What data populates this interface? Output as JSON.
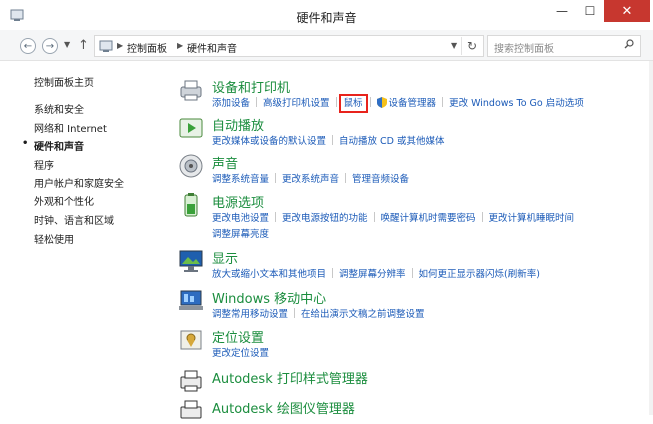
{
  "window": {
    "title": "硬件和声音",
    "close": "✕",
    "max": "☐",
    "min": "—"
  },
  "address": {
    "crumbs": [
      "控制面板",
      "硬件和声音"
    ],
    "search_placeholder": "搜索控制面板"
  },
  "sidebar": {
    "items": [
      "控制面板主页",
      "系统和安全",
      "网络和 Internet",
      "硬件和声音",
      "程序",
      "用户帐户和家庭安全",
      "外观和个性化",
      "时钟、语言和区域",
      "轻松使用"
    ],
    "active_index": 3
  },
  "categories": [
    {
      "title": "设备和打印机",
      "links": [
        "添加设备",
        "高级打印机设置",
        "鼠标",
        "设备管理器",
        "更改 Windows To Go 启动选项"
      ]
    },
    {
      "title": "自动播放",
      "links": [
        "更改媒体或设备的默认设置",
        "自动播放 CD 或其他媒体"
      ]
    },
    {
      "title": "声音",
      "links": [
        "调整系统音量",
        "更改系统声音",
        "管理音频设备"
      ]
    },
    {
      "title": "电源选项",
      "links": [
        "更改电池设置",
        "更改电源按钮的功能",
        "唤醒计算机时需要密码",
        "更改计算机睡眠时间",
        "调整屏幕亮度"
      ]
    },
    {
      "title": "显示",
      "links": [
        "放大或缩小文本和其他项目",
        "调整屏幕分辨率",
        "如何更正显示器闪烁(刷新率)"
      ]
    },
    {
      "title": "Windows 移动中心",
      "links": [
        "调整常用移动设置",
        "在给出演示文稿之前调整设置"
      ]
    },
    {
      "title": "定位设置",
      "links": [
        "更改定位设置"
      ]
    },
    {
      "title": "Autodesk 打印样式管理器",
      "links": []
    },
    {
      "title": "Autodesk 绘图仪管理器",
      "links": []
    }
  ],
  "colors": {
    "link": "#1c5bb8",
    "category_title": "#1b8d3e",
    "highlight_box": "#e8231c",
    "close_button": "#c7372f"
  }
}
